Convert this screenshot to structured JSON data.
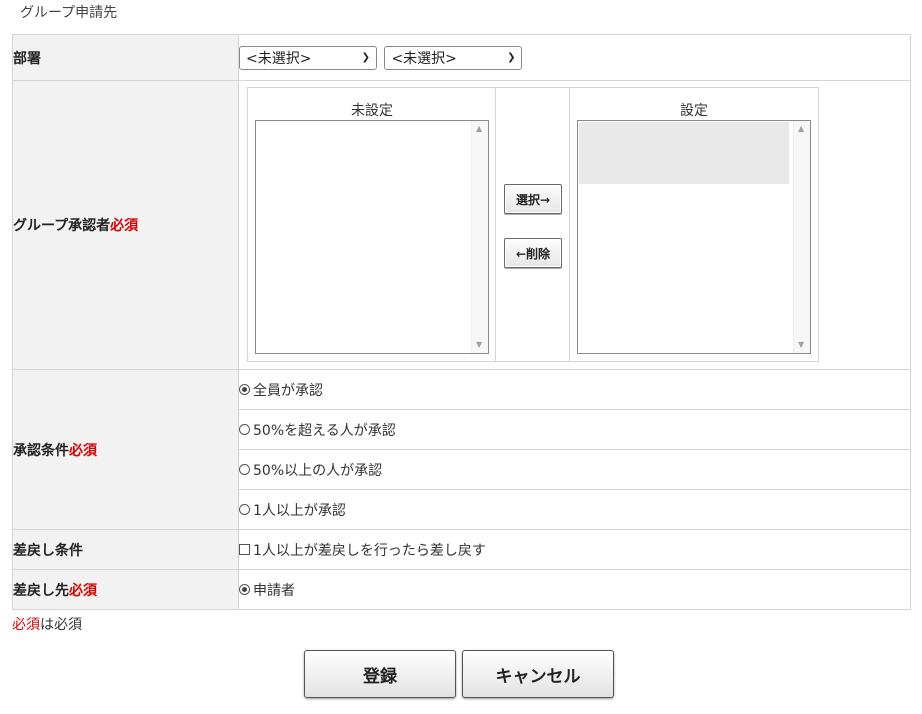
{
  "page": {
    "title": "グループ申請先"
  },
  "form": {
    "department": {
      "label": "部署",
      "select1": "<未選択>",
      "select2": "<未選択>"
    },
    "approver": {
      "label": "グループ承認者",
      "required": "必須",
      "unset_title": "未設定",
      "set_title": "設定",
      "unset_items": [],
      "set_items_note": "blurred entries",
      "select_button": "選択→",
      "delete_button": "←削除"
    },
    "condition": {
      "label": "承認条件",
      "required": "必須",
      "options": [
        {
          "label": "全員が承認",
          "selected": true
        },
        {
          "label": "50%を超える人が承認",
          "selected": false
        },
        {
          "label": "50%以上の人が承認",
          "selected": false
        },
        {
          "label": "1人以上が承認",
          "selected": false
        }
      ]
    },
    "return_condition": {
      "label": "差戻し条件",
      "checkbox_label": "1人以上が差戻しを行ったら差し戻す",
      "checked": false
    },
    "return_to": {
      "label": "差戻し先",
      "required": "必須",
      "option": "申請者",
      "selected": true
    }
  },
  "footnote": {
    "required_word": "必須",
    "text": "は必須"
  },
  "buttons": {
    "register": "登録",
    "cancel": "キャンセル"
  }
}
